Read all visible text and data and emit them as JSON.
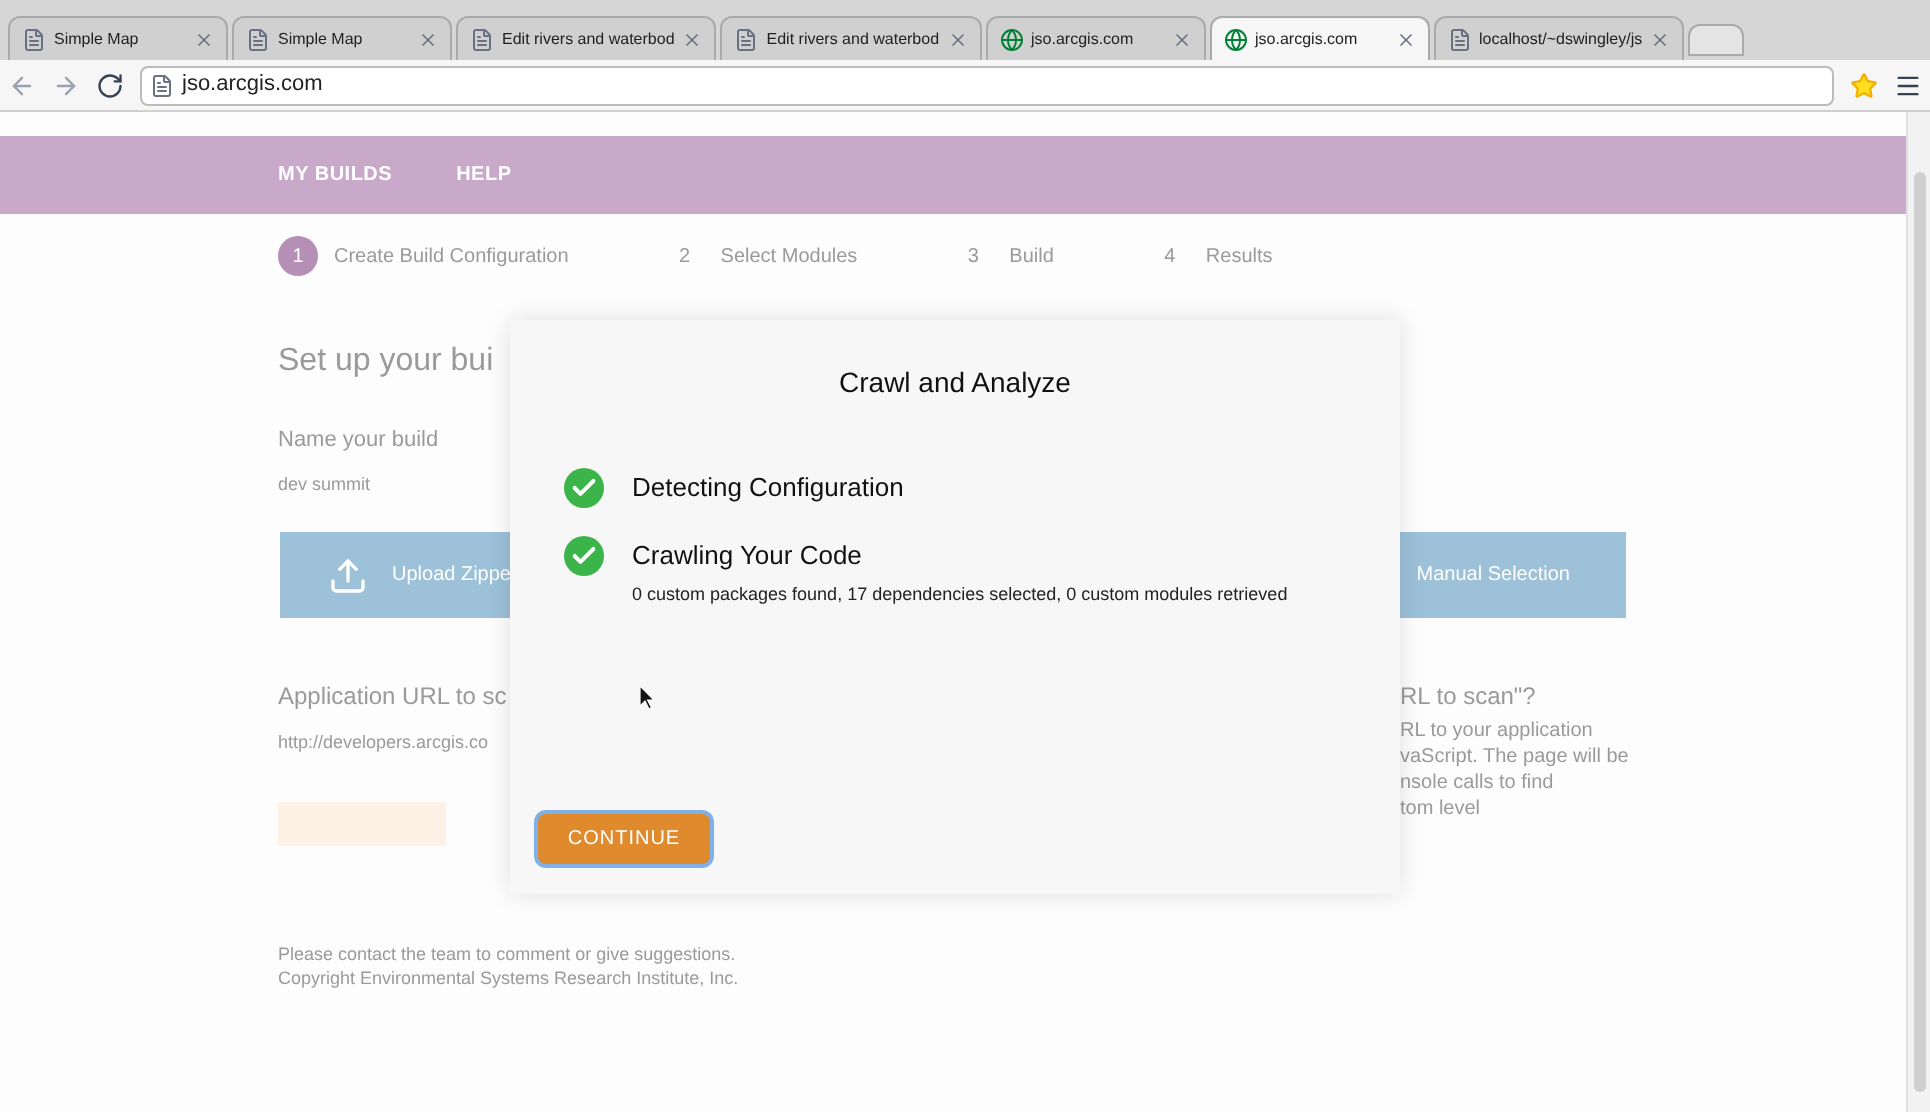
{
  "browser": {
    "tabs": [
      {
        "title": "Simple Map",
        "kind": "page",
        "selected": false
      },
      {
        "title": "Simple Map",
        "kind": "page",
        "selected": false
      },
      {
        "title": "Edit rivers and waterbod",
        "kind": "page",
        "selected": false
      },
      {
        "title": "Edit rivers and waterbod",
        "kind": "page",
        "selected": false
      },
      {
        "title": "jso.arcgis.com",
        "kind": "globe",
        "selected": false
      },
      {
        "title": "jso.arcgis.com",
        "kind": "globe",
        "selected": true
      },
      {
        "title": "localhost/~dswingley/js",
        "kind": "page",
        "selected": false
      }
    ],
    "address": "jso.arcgis.com"
  },
  "nav": [
    "MY BUILDS",
    "HELP"
  ],
  "steps": [
    {
      "number": "1",
      "label": "Create Build Configuration",
      "selected": true
    },
    {
      "number": "2",
      "label": "Select Modules",
      "selected": false
    },
    {
      "number": "3",
      "label": "Build",
      "selected": false
    },
    {
      "number": "4",
      "label": "Results",
      "selected": false
    }
  ],
  "page": {
    "heading": "Set up your bui",
    "name_label": "Name your build",
    "name_value": "dev summit",
    "upload_label": "Upload Zippe",
    "manual_label": "Manual Selection",
    "url_label": "Application URL to sc",
    "url_value": "http://developers.arcgis.co",
    "help_title": "RL to scan\"?",
    "help_lines": [
      "RL to your application",
      "vaScript. The page will be",
      "nsole calls to find",
      "tom level"
    ],
    "footer": [
      "Please contact the team to comment or give suggestions.",
      "Copyright Environmental Systems Research Institute, Inc."
    ]
  },
  "dialog": {
    "title": "Crawl and Analyze",
    "items": [
      {
        "label": "Detecting Configuration",
        "done": true
      },
      {
        "label": "Crawling Your Code",
        "done": true,
        "detail": "0 custom packages found, 17 dependencies selected, 0 custom modules retrieved"
      }
    ],
    "button": "CONTINUE"
  }
}
